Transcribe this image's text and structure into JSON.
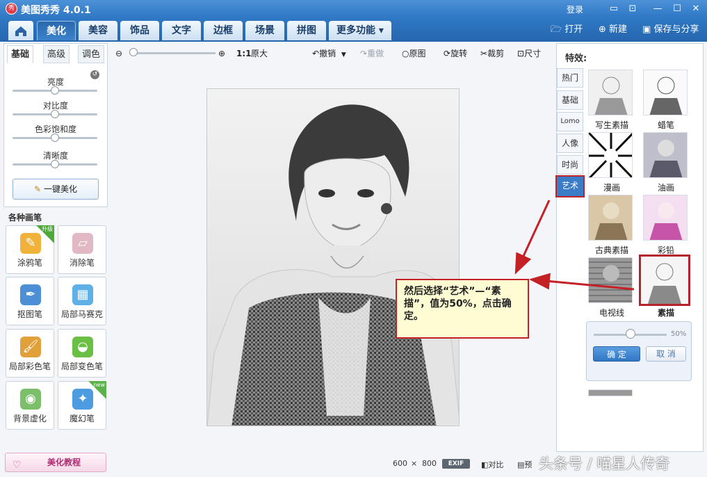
{
  "titlebar": {
    "logo_text": "秀",
    "title": "美图秀秀 4.0.1",
    "login": "登录",
    "btn_msg": "▭",
    "btn_skin": "⊡",
    "btn_min": "—",
    "btn_max": "☐",
    "btn_close": "✕"
  },
  "tabs": [
    {
      "label": "美化",
      "active": true
    },
    {
      "label": "美容"
    },
    {
      "label": "饰品"
    },
    {
      "label": "文字"
    },
    {
      "label": "边框"
    },
    {
      "label": "场景"
    },
    {
      "label": "拼图"
    },
    {
      "label": "更多功能 ▾"
    }
  ],
  "top_actions": {
    "open": "打开",
    "new": "新建",
    "save_share": "保存与分享"
  },
  "left": {
    "subtabs": [
      "基础",
      "高级",
      "调色"
    ],
    "sliders": [
      {
        "label": "亮度",
        "value": 0.5
      },
      {
        "label": "对比度",
        "value": 0.5
      },
      {
        "label": "色彩饱和度",
        "value": 0.5
      },
      {
        "label": "清晰度",
        "value": 0.5
      }
    ],
    "one_click": "一键美化",
    "brush_title": "各种画笔",
    "brushes": [
      {
        "label": "涂鸦笔",
        "badge": "升级"
      },
      {
        "label": "消除笔"
      },
      {
        "label": "抠图笔"
      },
      {
        "label": "局部马赛克"
      },
      {
        "label": "局部彩色笔"
      },
      {
        "label": "局部变色笔"
      },
      {
        "label": "背景虚化"
      },
      {
        "label": "魔幻笔",
        "badge": "new"
      }
    ],
    "tutorial": "美化教程"
  },
  "toolbar": {
    "zoom_ratio": "1:1",
    "original_size": "原大",
    "undo": "撤销",
    "redo": "重做",
    "original": "原图",
    "rotate": "旋转",
    "crop": "裁剪",
    "size": "尺寸"
  },
  "status": {
    "width": "600",
    "times": "×",
    "height": "800",
    "exif": "EXIF",
    "compare": "对比",
    "preview": "预"
  },
  "watermark": "头条号 / 喵星人传奇",
  "right": {
    "title": "特效:",
    "categories": [
      {
        "label": "热门"
      },
      {
        "label": "基础"
      },
      {
        "label": "Lomo"
      },
      {
        "label": "人像"
      },
      {
        "label": "时尚"
      },
      {
        "label": "艺术",
        "active": true
      }
    ],
    "effects": [
      {
        "label": "写生素描"
      },
      {
        "label": "蜡笔"
      },
      {
        "label": "漫画"
      },
      {
        "label": "油画"
      },
      {
        "label": "古典素描"
      },
      {
        "label": "彩铅"
      },
      {
        "label": "电视线"
      },
      {
        "label": "素描",
        "selected": true
      }
    ],
    "intensity": {
      "value": 0.5,
      "display": "50%"
    },
    "confirm": "确 定",
    "cancel": "取 消"
  },
  "callout": "然后选择“艺术”—“素描”，值为50%，点击确定。",
  "colors": {
    "title_blue": "#2f78c4",
    "accent_red": "#c42127",
    "callout_bg": "#fefcd2"
  }
}
